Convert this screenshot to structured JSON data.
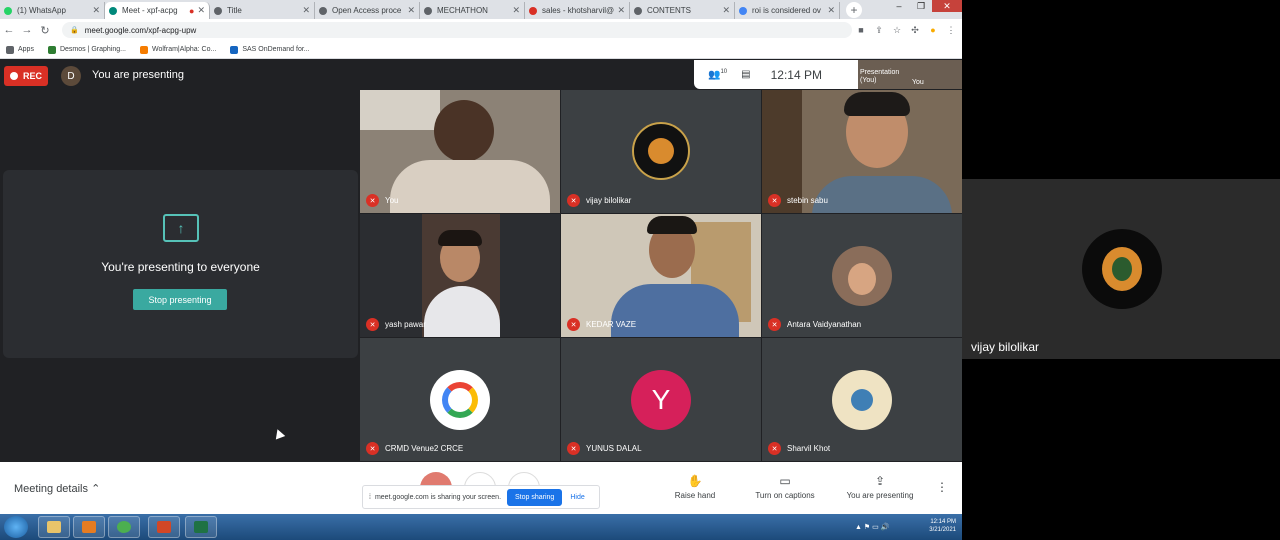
{
  "browser": {
    "tabs": [
      {
        "title": "(1) WhatsApp",
        "color": "#25d366"
      },
      {
        "title": "Meet - xpf-acpg",
        "color": "#00897b",
        "active": true
      },
      {
        "title": "Title",
        "color": "#5f6368"
      },
      {
        "title": "Open Access proce",
        "color": "#5f6368"
      },
      {
        "title": "MECHATHON",
        "color": "#5f6368"
      },
      {
        "title": "sales - khotsharvil@",
        "color": "#d93025"
      },
      {
        "title": "CONTENTS",
        "color": "#5f6368"
      },
      {
        "title": "roi is considered ov",
        "color": "#4285f4"
      }
    ],
    "url": "meet.google.com/xpf-acpg-upw",
    "bookmarks": [
      {
        "label": "Apps",
        "color": "#5f6368"
      },
      {
        "label": "Desmos | Graphing...",
        "color": "#2e7d32"
      },
      {
        "label": "Wolfram|Alpha: Co...",
        "color": "#f57c00"
      },
      {
        "label": "SAS OnDemand for...",
        "color": "#1565c0"
      }
    ]
  },
  "meet": {
    "rec_label": "REC",
    "presenter_initial": "D",
    "presenting_banner": "You are presenting",
    "participant_count": "10",
    "time": "12:14 PM",
    "self_thumb": {
      "line1": "Presentation",
      "line2": "(You)",
      "line3": "You"
    },
    "presentation_panel": {
      "message": "You're presenting to everyone",
      "stop_button": "Stop presenting"
    },
    "tiles": [
      {
        "name": "You"
      },
      {
        "name": "vijay bilolikar"
      },
      {
        "name": "stebin sabu"
      },
      {
        "name": "yash pawar"
      },
      {
        "name": "KEDAR VAZE"
      },
      {
        "name": "Antara Vaidyanathan"
      },
      {
        "name": "CRMD Venue2 CRCE"
      },
      {
        "name": "YUNUS DALAL",
        "initial": "Y"
      },
      {
        "name": "Sharvil Khot"
      }
    ],
    "spotlight_name": "vijay bilolikar",
    "bottom": {
      "meeting_details": "Meeting details",
      "raise_hand": "Raise hand",
      "captions": "Turn on captions",
      "presenting": "You are presenting",
      "share_notice": "meet.google.com is sharing your screen.",
      "stop_sharing": "Stop sharing",
      "hide": "Hide"
    }
  },
  "taskbar": {
    "time": "12:14 PM",
    "date": "3/21/2021"
  }
}
